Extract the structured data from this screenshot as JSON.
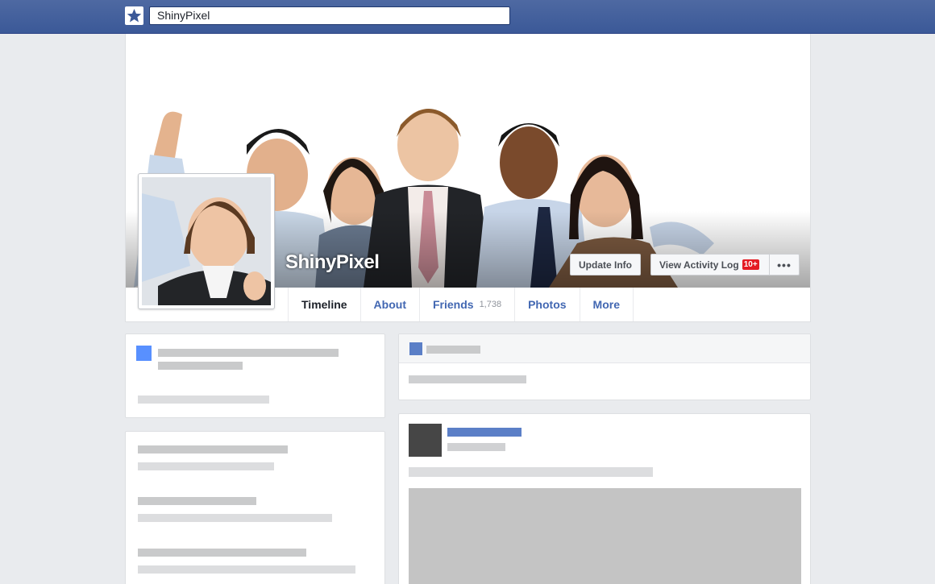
{
  "topbar": {
    "logo_icon": "star-icon",
    "search_value": "ShinyPixel",
    "brand_color": "#3b5998"
  },
  "profile": {
    "name": "ShinyPixel",
    "update_info_label": "Update Info",
    "activity_log_label": "View Activity Log",
    "activity_badge": "10+",
    "more_label": "•••"
  },
  "tabs": [
    {
      "label": "Timeline",
      "count": ""
    },
    {
      "label": "About",
      "count": ""
    },
    {
      "label": "Friends",
      "count": "1,738"
    },
    {
      "label": "Photos",
      "count": ""
    },
    {
      "label": "More",
      "count": ""
    }
  ]
}
